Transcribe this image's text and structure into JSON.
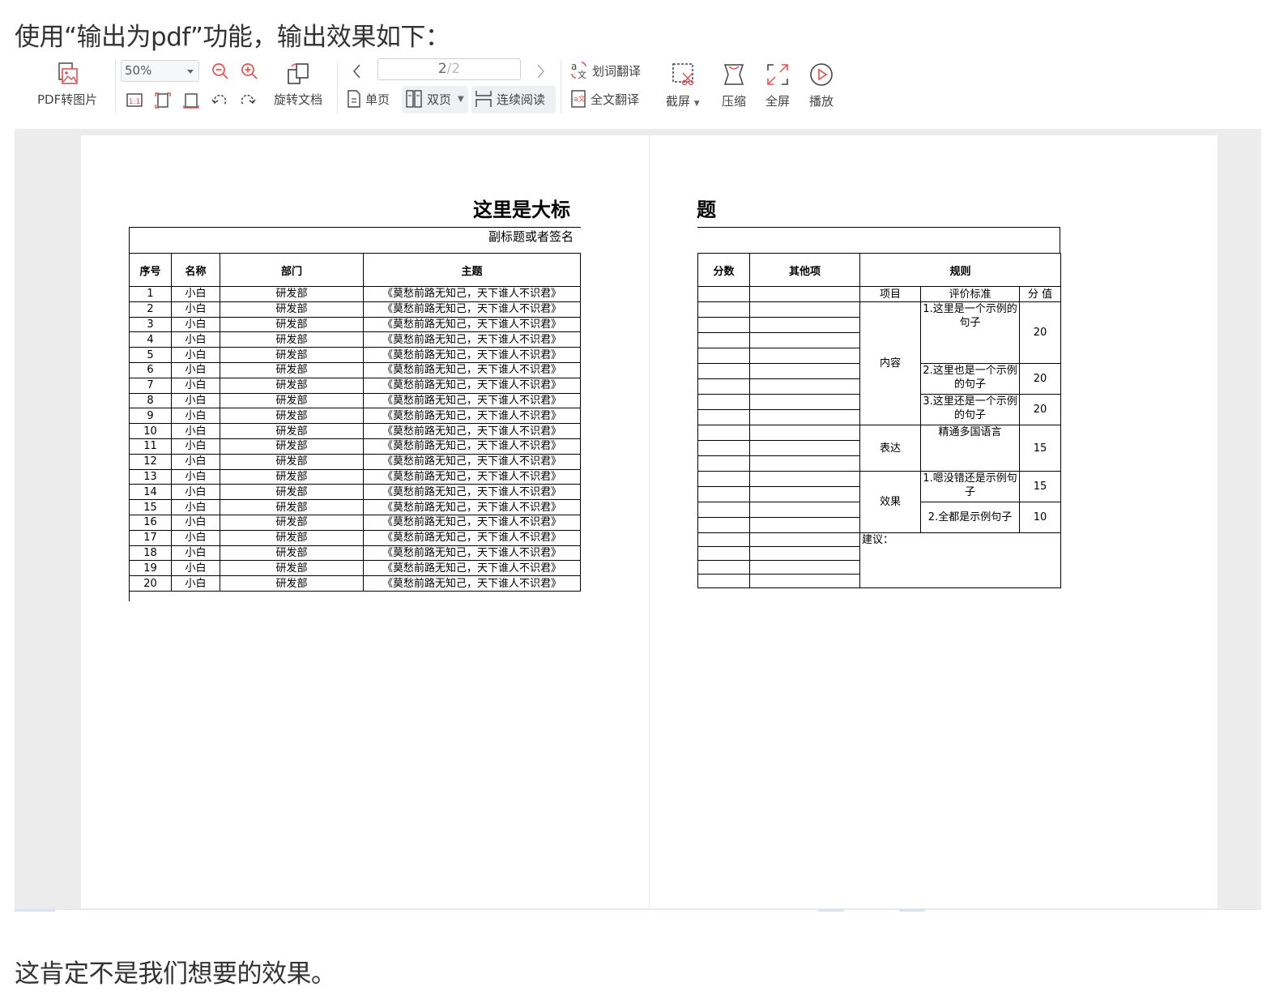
{
  "intro_text": "使用“输出为pdf”功能，输出效果如下：",
  "outro_text": "这肯定不是我们想要的效果。",
  "toolbar": {
    "pdf_to_image_label": "PDF转图片",
    "zoom_value": "50%",
    "rotate_doc_label": "旋转文档",
    "page_current": "2",
    "page_total": "/2",
    "single_page_label": "单页",
    "double_page_label": "双页",
    "continuous_label": "连续阅读",
    "word_translate_label": "划词翻译",
    "full_translate_label": "全文翻译",
    "screenshot_label": "截屏",
    "compress_label": "压缩",
    "fullscreen_label": "全屏",
    "play_label": "播放"
  },
  "document": {
    "title_left_fragment": "这里是大标",
    "title_right_fragment": "题",
    "subtitle_left_fragment": "副标题或者签名",
    "left_table": {
      "headers": [
        "序号",
        "名称",
        "部门",
        "主题"
      ],
      "rows": [
        [
          "1",
          "小白",
          "研发部",
          "《莫愁前路无知己，天下谁人不识君》"
        ],
        [
          "2",
          "小白",
          "研发部",
          "《莫愁前路无知己，天下谁人不识君》"
        ],
        [
          "3",
          "小白",
          "研发部",
          "《莫愁前路无知己，天下谁人不识君》"
        ],
        [
          "4",
          "小白",
          "研发部",
          "《莫愁前路无知己，天下谁人不识君》"
        ],
        [
          "5",
          "小白",
          "研发部",
          "《莫愁前路无知己，天下谁人不识君》"
        ],
        [
          "6",
          "小白",
          "研发部",
          "《莫愁前路无知己，天下谁人不识君》"
        ],
        [
          "7",
          "小白",
          "研发部",
          "《莫愁前路无知己，天下谁人不识君》"
        ],
        [
          "8",
          "小白",
          "研发部",
          "《莫愁前路无知己，天下谁人不识君》"
        ],
        [
          "9",
          "小白",
          "研发部",
          "《莫愁前路无知己，天下谁人不识君》"
        ],
        [
          "10",
          "小白",
          "研发部",
          "《莫愁前路无知己，天下谁人不识君》"
        ],
        [
          "11",
          "小白",
          "研发部",
          "《莫愁前路无知己，天下谁人不识君》"
        ],
        [
          "12",
          "小白",
          "研发部",
          "《莫愁前路无知己，天下谁人不识君》"
        ],
        [
          "13",
          "小白",
          "研发部",
          "《莫愁前路无知己，天下谁人不识君》"
        ],
        [
          "14",
          "小白",
          "研发部",
          "《莫愁前路无知己，天下谁人不识君》"
        ],
        [
          "15",
          "小白",
          "研发部",
          "《莫愁前路无知己，天下谁人不识君》"
        ],
        [
          "16",
          "小白",
          "研发部",
          "《莫愁前路无知己，天下谁人不识君》"
        ],
        [
          "17",
          "小白",
          "研发部",
          "《莫愁前路无知己，天下谁人不识君》"
        ],
        [
          "18",
          "小白",
          "研发部",
          "《莫愁前路无知己，天下谁人不识君》"
        ],
        [
          "19",
          "小白",
          "研发部",
          "《莫愁前路无知己，天下谁人不识君》"
        ],
        [
          "20",
          "小白",
          "研发部",
          "《莫愁前路无知己，天下谁人不识君》"
        ]
      ]
    },
    "right_table": {
      "headers": [
        "分数",
        "其他项",
        "规则"
      ],
      "sub_headers": [
        "项目",
        "评价标准",
        "分 值"
      ],
      "groups": [
        {
          "name": "内容",
          "items": [
            {
              "criterion": "1.这里是一个示例的句子",
              "score": "20"
            },
            {
              "criterion": "2.这里也是一个示例的句子",
              "score": "20"
            },
            {
              "criterion": "3.这里还是一个示例的句子",
              "score": "20"
            }
          ]
        },
        {
          "name": "表达",
          "items": [
            {
              "criterion": "精通多国语言",
              "score": "15"
            }
          ]
        },
        {
          "name": "效果",
          "items": [
            {
              "criterion": "1.嗯没错还是示例句子",
              "score": "15"
            },
            {
              "criterion": "2.全都是示例句子",
              "score": "10"
            }
          ]
        }
      ],
      "suggestion_label": "建议："
    }
  }
}
